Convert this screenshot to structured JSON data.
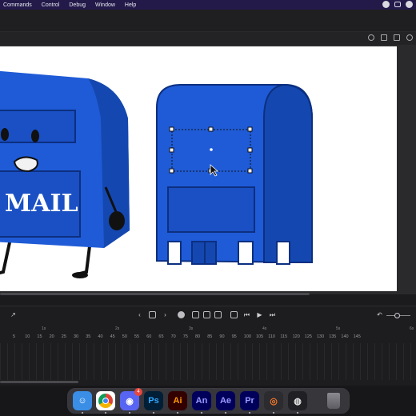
{
  "menubar": {
    "items": [
      "Commands",
      "Control",
      "Debug",
      "Window",
      "Help"
    ]
  },
  "stage": {
    "mailbox_text": "MAIL",
    "background_color": "#ffffff",
    "mailbox_color": "#1f5bd6"
  },
  "timeline": {
    "seconds_markers": [
      "1s",
      "2s",
      "3s",
      "4s",
      "5s",
      "6s"
    ],
    "frame_numbers": [
      "5",
      "10",
      "15",
      "20",
      "25",
      "30",
      "35",
      "40",
      "45",
      "50",
      "55",
      "60",
      "65",
      "70",
      "75",
      "80",
      "85",
      "90",
      "95",
      "100",
      "105",
      "110",
      "115",
      "120",
      "125",
      "130",
      "135",
      "140",
      "145"
    ],
    "playback_controls": [
      "first-frame",
      "step-back",
      "play",
      "step-forward",
      "last-frame"
    ]
  },
  "dock": {
    "apps": [
      {
        "name": "Finder",
        "label": "",
        "bg": "#3a8ee6"
      },
      {
        "name": "Chrome",
        "label": "",
        "bg": "#ffffff"
      },
      {
        "name": "Discord",
        "label": "",
        "bg": "#5865f2",
        "badge": "4"
      },
      {
        "name": "Photoshop",
        "label": "Ps",
        "bg": "#001e36",
        "fg": "#31a8ff"
      },
      {
        "name": "Illustrator",
        "label": "Ai",
        "bg": "#330000",
        "fg": "#ff9a00"
      },
      {
        "name": "Animate",
        "label": "An",
        "bg": "#00005b",
        "fg": "#9999ff"
      },
      {
        "name": "After Effects",
        "label": "Ae",
        "bg": "#00005b",
        "fg": "#9999ff"
      },
      {
        "name": "Premiere Pro",
        "label": "Pr",
        "bg": "#00005b",
        "fg": "#9999ff"
      },
      {
        "name": "Blender",
        "label": "",
        "bg": "#2b2b30"
      },
      {
        "name": "OBS",
        "label": "",
        "bg": "#1f1f24"
      },
      {
        "name": "Trash",
        "label": "",
        "bg": "transparent"
      }
    ]
  }
}
